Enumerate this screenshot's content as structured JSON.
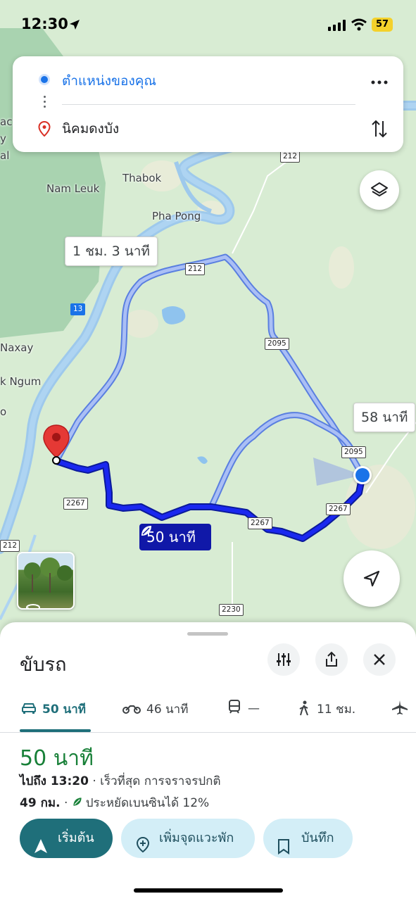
{
  "status_bar": {
    "time": "12:30",
    "battery": "57"
  },
  "search_card": {
    "origin": "ตำแหน่งของคุณ",
    "destination": "นิคมดงบัง"
  },
  "map": {
    "places": [
      "Thabok",
      "Nam Leuk",
      "Pha Pong",
      "Naxay",
      "k Ngum",
      "ac",
      "y",
      "al",
      "o"
    ],
    "shields": [
      "212",
      "212",
      "13",
      "2095",
      "2095",
      "2267",
      "2267",
      "2267",
      "212",
      "2230"
    ],
    "callouts": {
      "alt1": "1 ชม. 3 นาที",
      "alt2": "58 นาที",
      "main": "50 นาที"
    }
  },
  "sheet": {
    "title": "ขับรถ",
    "modes": [
      {
        "icon": "car-icon",
        "label": "50 นาที"
      },
      {
        "icon": "motorcycle-icon",
        "label": "46 นาที"
      },
      {
        "icon": "transit-icon",
        "label": "—"
      },
      {
        "icon": "walk-icon",
        "label": "11 ชม."
      }
    ],
    "duration": "50 นาที",
    "arrival": "ไปถึง 13:20",
    "arrival_note": " · เร็วที่สุด การจราจรปกติ",
    "distance": "49 กม.",
    "fuel_note": "ประหยัดเบนซินได้ 12%",
    "buttons": {
      "start": "เริ่มต้น",
      "add_stop": "เพิ่มจุดแวะพัก",
      "save": "บันทึก"
    }
  },
  "colors": {
    "accent": "#1f6f7a",
    "route": "#1018e8",
    "duration_green": "#188038"
  }
}
